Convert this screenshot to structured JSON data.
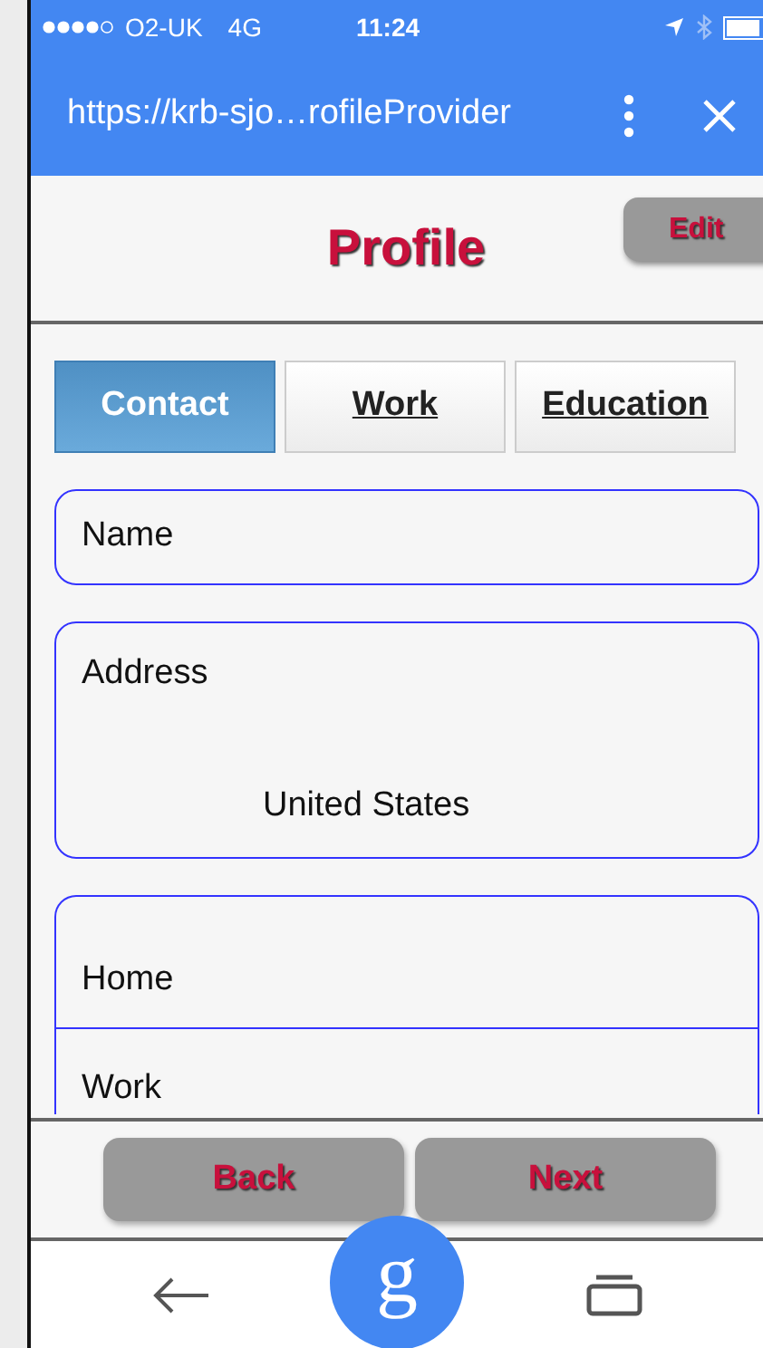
{
  "status_bar": {
    "carrier": "O2-UK",
    "network": "4G",
    "time": "11:24"
  },
  "browser_bar": {
    "url": "https://krb-sjo…rofileProvider"
  },
  "header": {
    "title": "Profile",
    "edit_button": "Edit"
  },
  "tabs": [
    {
      "label": "Contact",
      "selected": true
    },
    {
      "label": "Work",
      "selected": false
    },
    {
      "label": "Education",
      "selected": false
    }
  ],
  "fields": [
    {
      "kind": "single",
      "label": "Name"
    },
    {
      "kind": "address",
      "label": "Address",
      "value": "United States"
    },
    {
      "kind": "group",
      "rows": [
        "Home",
        "Work"
      ]
    }
  ],
  "footer": {
    "buttons": [
      "Back",
      "Next"
    ]
  },
  "nav_bar": {
    "assistant_button": "g"
  }
}
